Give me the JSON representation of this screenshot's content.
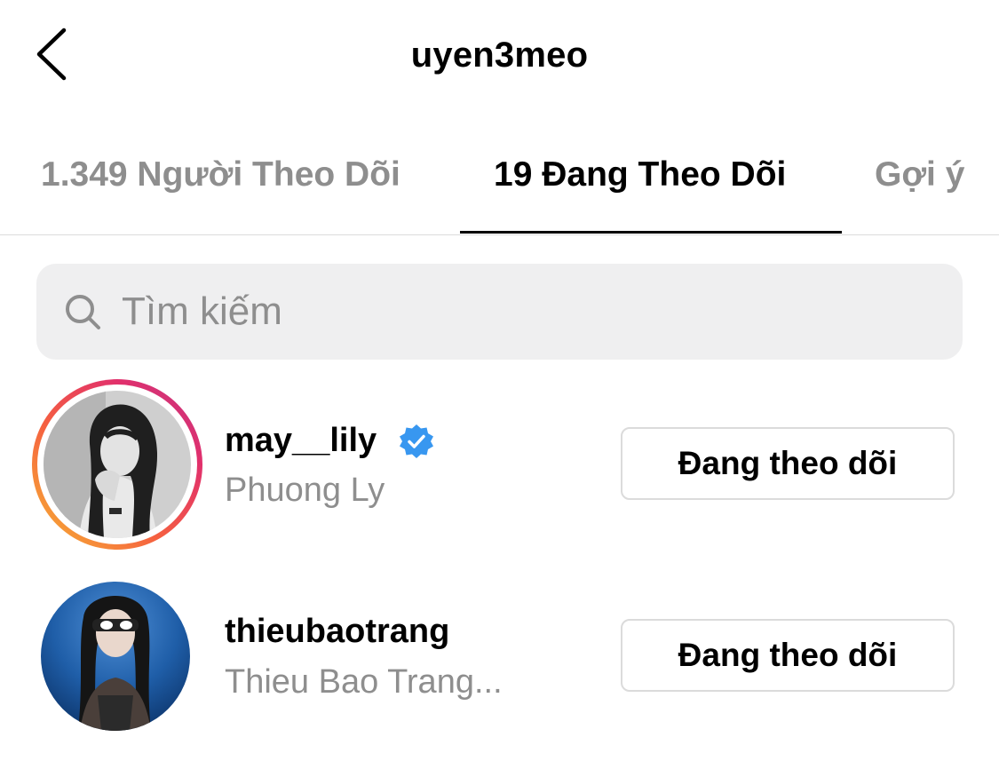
{
  "header": {
    "title": "uyen3meo",
    "back_icon": "chevron-left-icon"
  },
  "tabs": [
    {
      "label": "1.349 Người Theo Dõi",
      "active": false
    },
    {
      "label": "19 Đang Theo Dõi",
      "active": true
    },
    {
      "label": "Gợi ý",
      "active": false
    }
  ],
  "search": {
    "placeholder": "Tìm kiếm",
    "icon": "search-icon"
  },
  "accounts": [
    {
      "username": "may__lily",
      "full_name": "Phuong Ly",
      "verified": true,
      "has_story": true,
      "button_label": "Đang theo dõi"
    },
    {
      "username": "thieubaotrang",
      "full_name": "Thieu Bao Trang...",
      "verified": false,
      "has_story": false,
      "button_label": "Đang theo dõi"
    }
  ],
  "colors": {
    "text_primary": "#000000",
    "text_secondary": "#8e8e8e",
    "search_background": "#efeff0",
    "border": "#dbdbdb",
    "verified_badge": "#3897f0",
    "story_gradient": [
      "#f7b733",
      "#f56040",
      "#e1306c",
      "#c13584"
    ]
  }
}
